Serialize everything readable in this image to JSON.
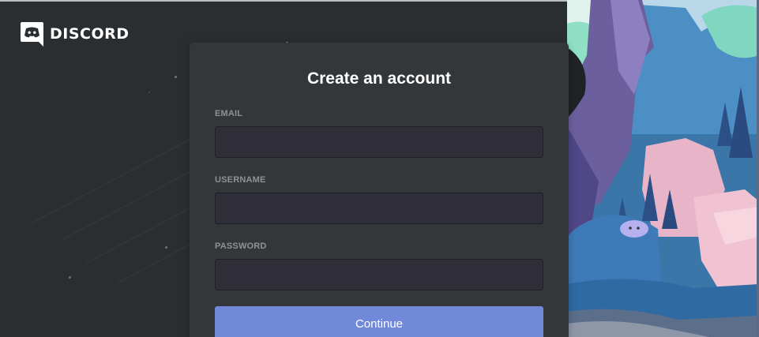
{
  "brand": {
    "logo_icon": "discord-logo-icon",
    "name": "DISCORD"
  },
  "form": {
    "title": "Create an account",
    "fields": [
      {
        "label": "EMAIL",
        "value": "",
        "type": "email"
      },
      {
        "label": "USERNAME",
        "value": "",
        "type": "text"
      },
      {
        "label": "PASSWORD",
        "value": "",
        "type": "password"
      }
    ],
    "submit_label": "Continue"
  },
  "colors": {
    "background": "#2a2e30",
    "card": "#33373a",
    "input": "#2e2d38",
    "accent": "#7289da",
    "label": "#8e9297"
  }
}
